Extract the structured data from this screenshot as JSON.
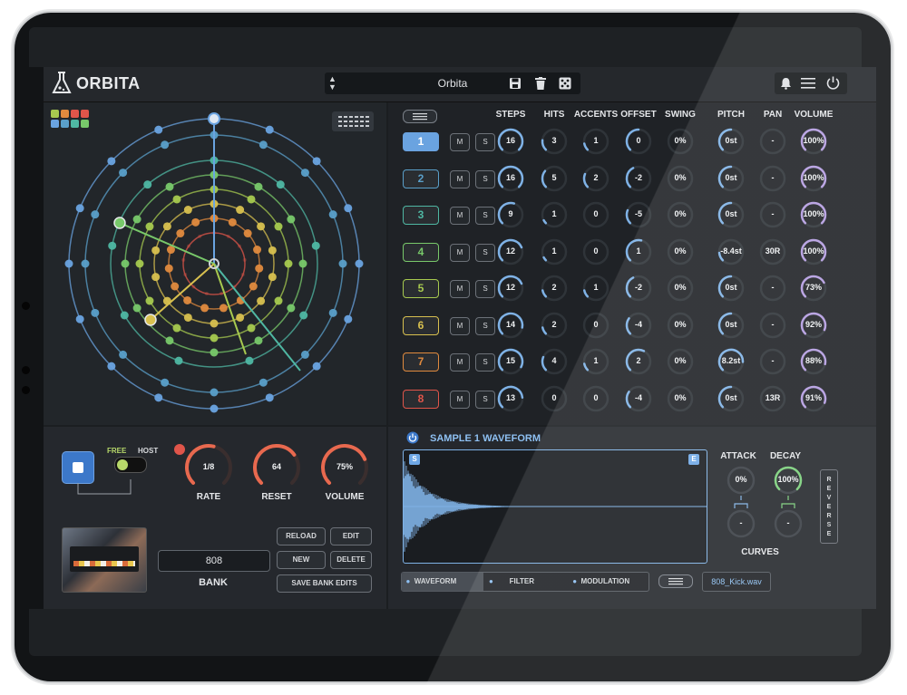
{
  "app": {
    "name": "ORBITA"
  },
  "preset": {
    "name": "Orbita"
  },
  "columns": [
    "STEPS",
    "HITS",
    "ACCENTS",
    "OFFSET",
    "SWING",
    "PITCH",
    "PAN",
    "VOLUME"
  ],
  "tracks": [
    {
      "num": "1",
      "color": "#6aa3e0",
      "selected": true,
      "steps": "16",
      "hits": "3",
      "accents": "1",
      "offset": "0",
      "swing": "0%",
      "pitch": "0st",
      "pan": "-",
      "volume": "100%"
    },
    {
      "num": "2",
      "color": "#5a9fc9",
      "selected": false,
      "steps": "16",
      "hits": "5",
      "accents": "2",
      "offset": "-2",
      "swing": "0%",
      "pitch": "0st",
      "pan": "-",
      "volume": "100%"
    },
    {
      "num": "3",
      "color": "#4fb7a3",
      "selected": false,
      "steps": "9",
      "hits": "1",
      "accents": "0",
      "offset": "-5",
      "swing": "0%",
      "pitch": "0st",
      "pan": "-",
      "volume": "100%"
    },
    {
      "num": "4",
      "color": "#78c86a",
      "selected": false,
      "steps": "12",
      "hits": "1",
      "accents": "0",
      "offset": "1",
      "swing": "0%",
      "pitch": "-8.4st",
      "pan": "30R",
      "volume": "100%"
    },
    {
      "num": "5",
      "color": "#a7c94f",
      "selected": false,
      "steps": "12",
      "hits": "2",
      "accents": "1",
      "offset": "-2",
      "swing": "0%",
      "pitch": "0st",
      "pan": "-",
      "volume": "73%"
    },
    {
      "num": "6",
      "color": "#d8c04f",
      "selected": false,
      "steps": "14",
      "hits": "2",
      "accents": "0",
      "offset": "-4",
      "swing": "0%",
      "pitch": "0st",
      "pan": "-",
      "volume": "92%"
    },
    {
      "num": "7",
      "color": "#e08a3e",
      "selected": false,
      "steps": "15",
      "hits": "4",
      "accents": "1",
      "offset": "2",
      "swing": "0%",
      "pitch": "8.2st",
      "pan": "-",
      "volume": "88%"
    },
    {
      "num": "8",
      "color": "#e0554a",
      "selected": false,
      "steps": "13",
      "hits": "0",
      "accents": "0",
      "offset": "-4",
      "swing": "0%",
      "pitch": "0st",
      "pan": "13R",
      "volume": "91%"
    }
  ],
  "transport": {
    "free": "FREE",
    "host": "HOST"
  },
  "knobs": [
    {
      "label": "RATE",
      "value": "1/8",
      "fraction": 0.55
    },
    {
      "label": "RESET",
      "value": "64",
      "fraction": 0.7
    },
    {
      "label": "VOLUME",
      "value": "75%",
      "fraction": 0.75
    }
  ],
  "bank": {
    "name": "808",
    "label": "BANK"
  },
  "bank_buttons": {
    "reload": "RELOAD",
    "edit": "EDIT",
    "new": "NEW",
    "delete": "DELETE",
    "save": "SAVE BANK EDITS"
  },
  "waveform": {
    "title": "SAMPLE 1 WAVEFORM",
    "start": "S",
    "end": "E"
  },
  "envelope": {
    "attack_label": "ATTACK",
    "attack": "0%",
    "decay_label": "DECAY",
    "decay": "100%",
    "curve_a": "-",
    "curve_d": "-",
    "curves_label": "CURVES",
    "reverse": "REVERSE"
  },
  "tabs": [
    "WAVEFORM",
    "FILTER",
    "MODULATION"
  ],
  "sample_file": "808_Kick.wav",
  "colors": {
    "accent": "#4a8fd6",
    "bg": "#1f2226"
  }
}
